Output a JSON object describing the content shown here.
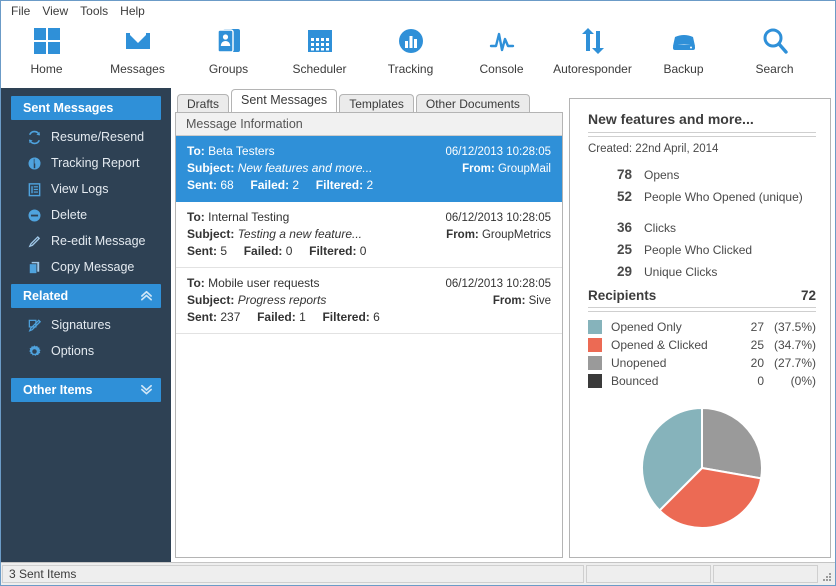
{
  "menubar": {
    "items": [
      "File",
      "View",
      "Tools",
      "Help"
    ]
  },
  "toolbar": {
    "buttons": [
      {
        "label": "Home",
        "icon": "home-grid-icon"
      },
      {
        "label": "Messages",
        "icon": "envelope-icon"
      },
      {
        "label": "Groups",
        "icon": "contacts-icon"
      },
      {
        "label": "Scheduler",
        "icon": "calendar-icon"
      },
      {
        "label": "Tracking",
        "icon": "bar-chart-circle-icon"
      },
      {
        "label": "Console",
        "icon": "pulse-icon"
      },
      {
        "label": "Autoresponder",
        "icon": "refresh-arrows-icon"
      },
      {
        "label": "Backup",
        "icon": "drive-icon"
      },
      {
        "label": "Search",
        "icon": "magnifier-icon"
      }
    ],
    "accent": "#2f90d8"
  },
  "sidebar": {
    "background": "#2e4154",
    "sections": [
      {
        "header": "Sent Messages",
        "chevron": "",
        "items": [
          {
            "label": "Resume/Resend",
            "icon": "refresh-icon"
          },
          {
            "label": "Tracking Report",
            "icon": "pie-chart-icon"
          },
          {
            "label": "View Logs",
            "icon": "log-list-icon"
          },
          {
            "label": "Delete",
            "icon": "minus-circle-icon"
          },
          {
            "label": "Re-edit Message",
            "icon": "pencil-icon"
          },
          {
            "label": "Copy Message",
            "icon": "copy-icon"
          }
        ]
      },
      {
        "header": "Related",
        "chevron": "»",
        "chevron_dir": "up",
        "items": [
          {
            "label": "Signatures",
            "icon": "signature-icon"
          },
          {
            "label": "Options",
            "icon": "gear-icon"
          }
        ]
      },
      {
        "header": "Other Items",
        "chevron": "»",
        "chevron_dir": "down",
        "items": []
      }
    ]
  },
  "tabs": [
    {
      "label": "Drafts",
      "active": false
    },
    {
      "label": "Sent Messages",
      "active": true
    },
    {
      "label": "Templates",
      "active": false
    },
    {
      "label": "Other Documents",
      "active": false
    }
  ],
  "list": {
    "header": "Message Information",
    "labels": {
      "to": "To:",
      "subject": "Subject:",
      "from": "From:",
      "sent": "Sent:",
      "failed": "Failed:",
      "filtered": "Filtered:"
    },
    "rows": [
      {
        "to": "Beta Testers",
        "subject": "New features and more...",
        "date": "06/12/2013 10:28:05",
        "from": "GroupMail",
        "sent": "68",
        "failed": "2",
        "filtered": "2",
        "selected": true
      },
      {
        "to": "Internal Testing",
        "subject": "Testing a new feature...",
        "date": "06/12/2013 10:28:05",
        "from": "GroupMetrics",
        "sent": "5",
        "failed": "0",
        "filtered": "0",
        "selected": false
      },
      {
        "to": "Mobile user requests",
        "subject": "Progress reports",
        "date": "06/12/2013 10:28:05",
        "from": "Sive",
        "sent": "237",
        "failed": "1",
        "filtered": "6",
        "selected": false
      }
    ]
  },
  "details": {
    "title": "New features and more...",
    "created": "Created: 22nd April, 2014",
    "stats": [
      {
        "value": "78",
        "label": "Opens"
      },
      {
        "value": "52",
        "label": "People Who Opened (unique)"
      },
      {
        "value": "36",
        "label": "Clicks"
      },
      {
        "value": "25",
        "label": "People Who Clicked"
      },
      {
        "value": "29",
        "label": "Unique Clicks"
      }
    ],
    "recipients_label": "Recipients",
    "recipients_total": "72"
  },
  "chart_data": {
    "type": "pie",
    "title": "Recipients",
    "total": 72,
    "categories": [
      "Opened Only",
      "Opened & Clicked",
      "Unopened",
      "Bounced"
    ],
    "values": [
      27,
      25,
      20,
      0
    ],
    "percents": [
      "(37.5%)",
      "(34.7%)",
      "(27.7%)",
      "(0%)"
    ],
    "colors": [
      "#86b3bb",
      "#ec6a54",
      "#9a9a9a",
      "#3a3a3a"
    ],
    "legend_position": "above",
    "start_angle_deg": 0,
    "direction": "clockwise",
    "slice_order": [
      "Unopened",
      "Opened & Clicked",
      "Opened Only"
    ]
  },
  "statusbar": {
    "text": "3 Sent Items",
    "panel2": "",
    "panel3": ""
  }
}
